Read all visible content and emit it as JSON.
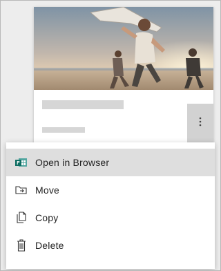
{
  "card": {
    "more_icon": "more-vertical-icon"
  },
  "menu": {
    "items": [
      {
        "label": "Open in Browser",
        "icon": "browser-app-icon",
        "active": true
      },
      {
        "label": "Move",
        "icon": "move-icon",
        "active": false
      },
      {
        "label": "Copy",
        "icon": "copy-icon",
        "active": false
      },
      {
        "label": "Delete",
        "icon": "delete-icon",
        "active": false
      }
    ]
  },
  "colors": {
    "active_item_bg": "#dedede",
    "more_button_bg": "#d2d2d2",
    "placeholder": "#d6d6d6",
    "backdrop": "#ededed"
  }
}
